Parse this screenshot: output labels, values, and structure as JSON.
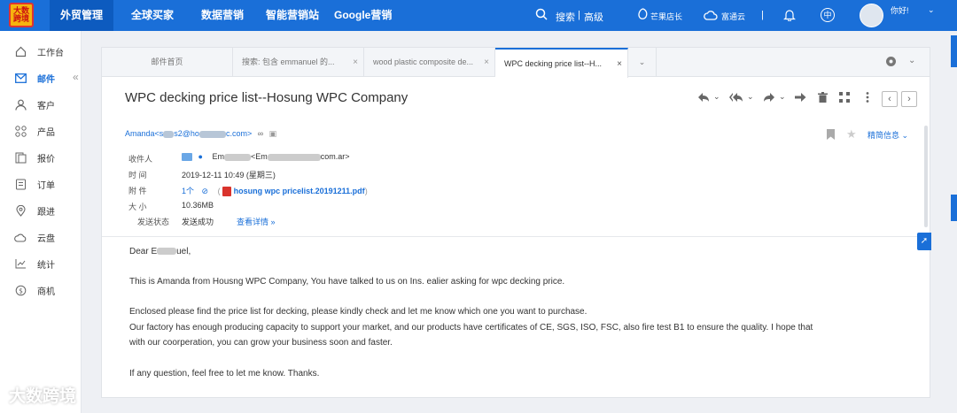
{
  "topbar": {
    "logo_text": "大数\n跨境",
    "nav": [
      "外贸管理",
      "全球买家",
      "数据营销",
      "智能营销站",
      "Google营销"
    ],
    "search_label": "搜索",
    "advanced_label": "高级",
    "mango_label": "芒果店长",
    "futong_label": "富通云",
    "lang_label": "中",
    "greeting": "你好!"
  },
  "sidebar": {
    "items": [
      {
        "label": "工作台",
        "icon": "home-icon"
      },
      {
        "label": "邮件",
        "icon": "mail-icon"
      },
      {
        "label": "客户",
        "icon": "user-icon"
      },
      {
        "label": "产品",
        "icon": "grid-icon"
      },
      {
        "label": "报价",
        "icon": "quote-icon"
      },
      {
        "label": "订单",
        "icon": "order-icon"
      },
      {
        "label": "跟进",
        "icon": "location-icon"
      },
      {
        "label": "云盘",
        "icon": "cloud-icon"
      },
      {
        "label": "统计",
        "icon": "chart-icon"
      },
      {
        "label": "商机",
        "icon": "opportunity-icon"
      }
    ],
    "active_index": 1
  },
  "tabs": [
    {
      "label": "邮件首页"
    },
    {
      "label": "搜索: 包含 emmanuel 的..."
    },
    {
      "label": "wood plastic composite de..."
    },
    {
      "label": "WPC decking price list--H..."
    }
  ],
  "email": {
    "subject": "WPC decking price list--Hosung WPC Company",
    "sender_name": "Amanda<s",
    "sender_mid": "s2@ho",
    "sender_tail": "c.com>",
    "detail_label": "精简信息",
    "recipient_label": "收件人",
    "recipient_value_a": "Em",
    "recipient_value_b": "<Em",
    "recipient_value_c": "com.ar>",
    "time_label": "时  间",
    "time_value": "2019-12-11 10:49 (星期三)",
    "attach_label": "附  件",
    "attach_count": "1个",
    "attach_name": "hosung wpc pricelist.20191211.pdf",
    "size_label": "大  小",
    "size_value": "10.36MB",
    "status_label": "发送状态",
    "status_value": "发送成功",
    "status_detail": "查看详情"
  },
  "body": {
    "greeting_a": "Dear E",
    "greeting_b": "uel,",
    "p1": "This is Amanda from Housng WPC Company, You have talked to us on Ins. ealier asking for wpc decking price.",
    "p2": "Enclosed please find the price list for decking, please kindly check and let me know which one you want to purchase.",
    "p3": "Our factory has enough producing capacity to support your market, and our products have certificates of CE, SGS, ISO, FSC, also fire test B1 to ensure the quality. I hope that",
    "p4": "with our coorperation, you can grow your business soon and faster.",
    "p5": "If any question, feel free to let me know. Thanks."
  },
  "watermark": "大数跨境",
  "colors": {
    "accent": "#1a6fd8",
    "topbar": "#1a6fd8",
    "logo": "#f6b40e"
  }
}
